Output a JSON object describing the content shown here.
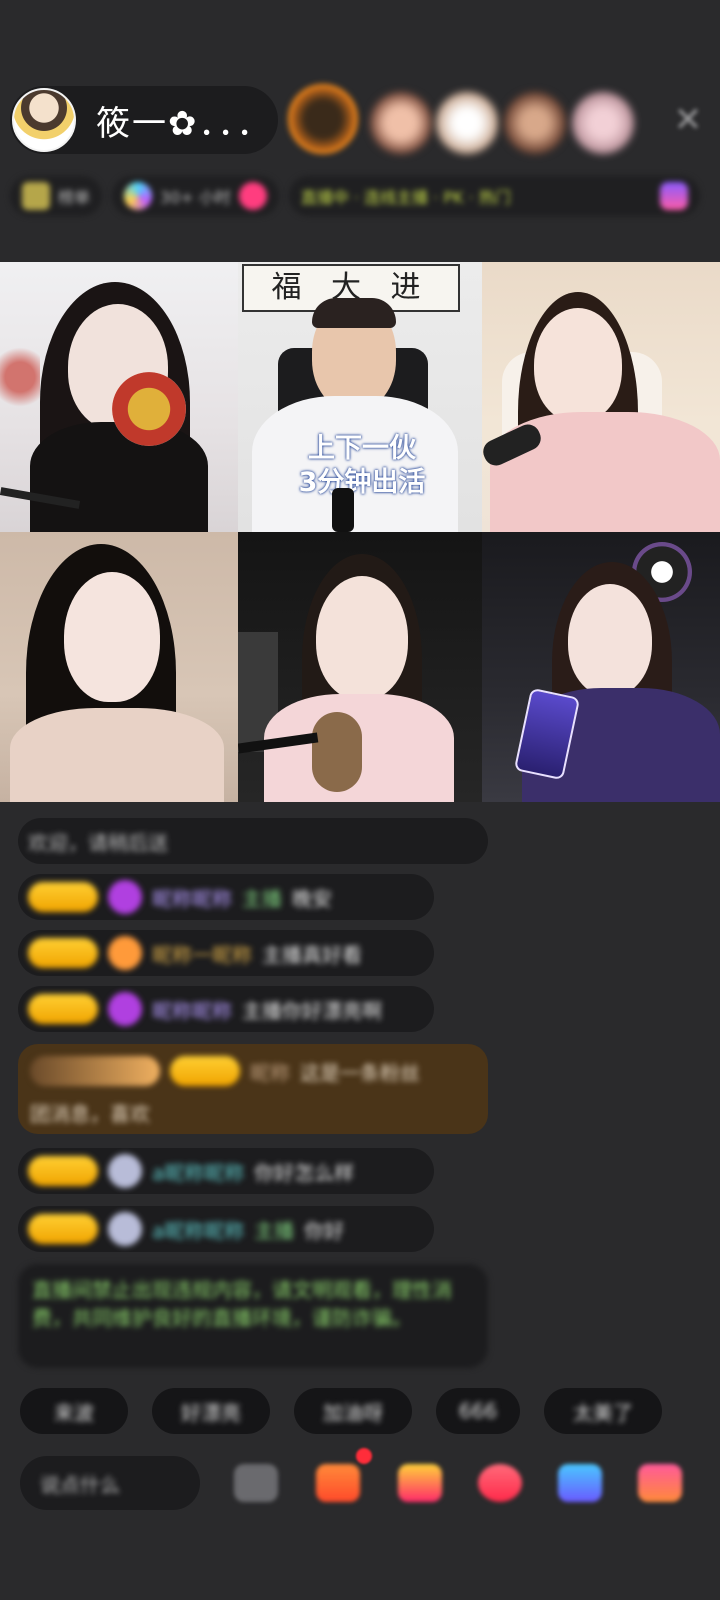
{
  "header": {
    "host_name": "筱一✿．．．",
    "close_symbol": "✕",
    "stats": [
      {
        "label": "榜单",
        "icon": "trophy-icon"
      },
      {
        "label": "30+ 小时",
        "icon": "planet-icon"
      },
      {
        "label": "",
        "icon": "fire-icon"
      }
    ],
    "promo": "直播中 · 连线主播 · PK · 热门",
    "colors": {
      "accent_green": "#c9df4a",
      "accent_pink": "#ff3d7f"
    }
  },
  "video_grid": {
    "tile_2_caption_line1": "上下一伙",
    "tile_2_caption_line2": "3分钟出活",
    "tile_2_calligraphy": "福 大 进"
  },
  "chat": {
    "messages": [
      {
        "user": "",
        "text": "欢迎，请稍后送"
      },
      {
        "user": "昵称昵称",
        "target": "主播",
        "text": "晚安"
      },
      {
        "user": "昵称一昵称",
        "text": "主播真好看"
      },
      {
        "user": "昵称昵称",
        "text": "主播你好漂亮啊"
      },
      {
        "user": "昵称",
        "text": "这是一条粉丝",
        "text2": "团消息，喜欢"
      },
      {
        "user": "a昵称昵称",
        "text": "你好怎么样"
      },
      {
        "user": "a昵称昵称",
        "target": "主播",
        "text": "你好"
      }
    ],
    "notice": "直播间禁止出现违规内容，请文明观看，理性消费，共同维护良好的直播环境，谨防诈骗。"
  },
  "quick_replies": [
    "来波",
    "好漂亮",
    "加油呀",
    "666",
    "太美了"
  ],
  "bottom_bar": {
    "say_placeholder": "说点什么",
    "icons": [
      "emoji-icon",
      "gift-box-icon",
      "gift-icon",
      "heart-icon",
      "share-icon",
      "more-icon"
    ]
  }
}
